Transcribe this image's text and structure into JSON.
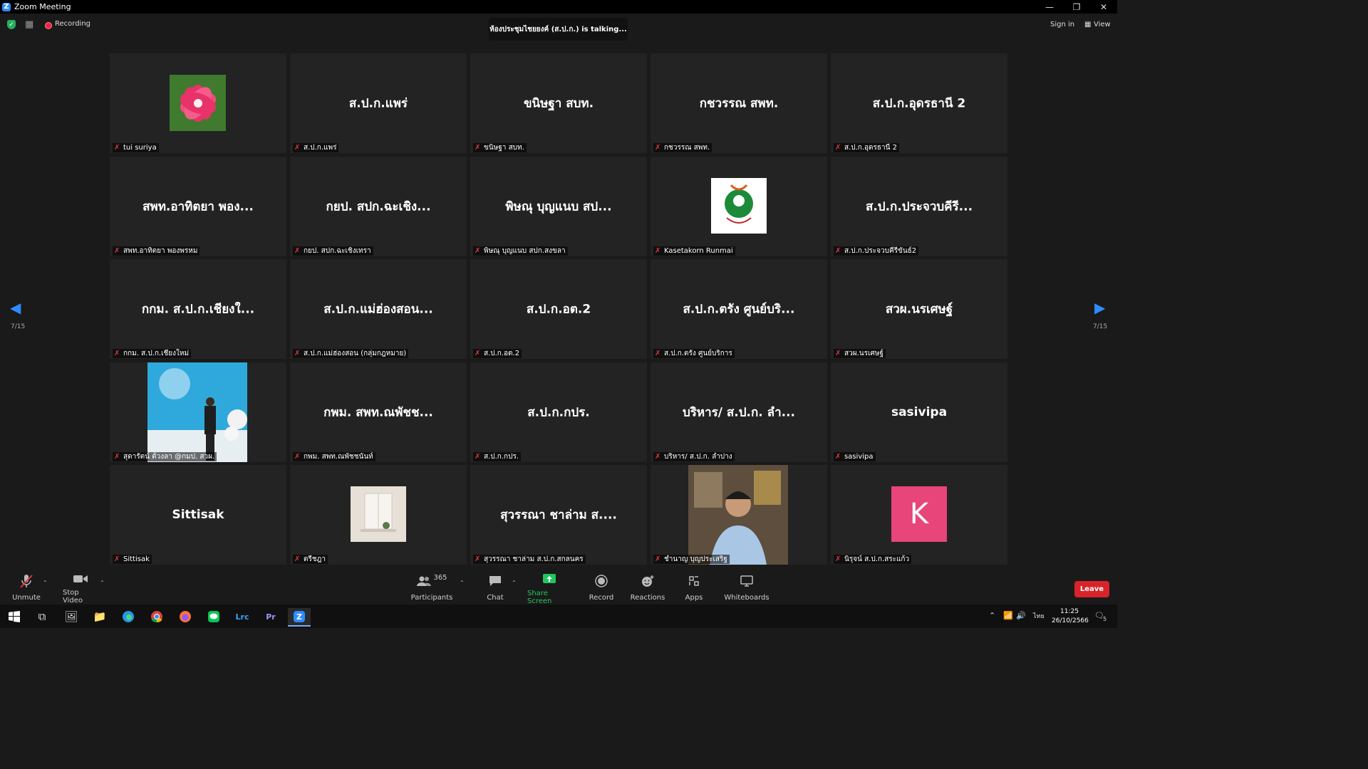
{
  "window": {
    "title": "Zoom Meeting",
    "controls": [
      "—",
      "❐",
      "✕"
    ]
  },
  "topbar": {
    "recording_label": "Recording",
    "talking_toast": "ห้องประชุมไชยยงค์ (ส.ป.ก.) is talking...",
    "signin_label": "Sign in",
    "view_label": "View"
  },
  "pagination": {
    "left": "7/15",
    "right": "7/15"
  },
  "participants": [
    {
      "tile_text": "",
      "label": "tui suriya",
      "avatar": "flower"
    },
    {
      "tile_text": "ส.ป.ก.แพร่",
      "label": "ส.ป.ก.แพร่"
    },
    {
      "tile_text": "ขนิษฐา สบท.",
      "label": "ขนิษฐา สบท."
    },
    {
      "tile_text": "กชวรรณ สพท.",
      "label": "กชวรรณ สพท."
    },
    {
      "tile_text": "ส.ป.ก.อุดรธานี 2",
      "label": "ส.ป.ก.อุดรธานี 2"
    },
    {
      "tile_text": "สพท.อาทิตยา พอง...",
      "label": "สพท.อาทิตยา พองพรหม"
    },
    {
      "tile_text": "กยป. สปก.ฉะเชิง...",
      "label": "กยป. สปก.ฉะเชิงเทรา"
    },
    {
      "tile_text": "พิษณุ บุญแนบ สป...",
      "label": "พิษณุ บุญแนบ สปก.สงขลา"
    },
    {
      "tile_text": "",
      "label": "Kasetakorn Runmai",
      "avatar": "logo"
    },
    {
      "tile_text": "ส.ป.ก.ประจวบคีรี...",
      "label": "ส.ป.ก.ประจวบคีรีขันธ์2"
    },
    {
      "tile_text": "กกม. ส.ป.ก.เชียงใ...",
      "label": "กกม. ส.ป.ก.เชียงใหม่"
    },
    {
      "tile_text": "ส.ป.ก.แม่ฮ่องสอน...",
      "label": "ส.ป.ก.แม่ฮ่องสอน (กลุ่มกฎหมาย)"
    },
    {
      "tile_text": "ส.ป.ก.อต.2",
      "label": "ส.ป.ก.อต.2"
    },
    {
      "tile_text": "ส.ป.ก.ตรัง ศูนย์บริ...",
      "label": "ส.ป.ก.ตรัง ศูนย์บริการ"
    },
    {
      "tile_text": "สวผ.นรเศษฐ์",
      "label": "สวผ.นรเศษฐ์"
    },
    {
      "tile_text": "",
      "label": "สุดารัตน์ ต้วงลา @กมป. สวผ.",
      "avatar": "photo-woman"
    },
    {
      "tile_text": "กพม. สพท.ณพัชช...",
      "label": "กพม. สพท.ณพัชชนันท์"
    },
    {
      "tile_text": "ส.ป.ก.กปร.",
      "label": "ส.ป.ก.กปร."
    },
    {
      "tile_text": "บริหาร/ ส.ป.ก. ลำ...",
      "label": "บริหาร/ ส.ป.ก. ลำปาง"
    },
    {
      "tile_text": "sasivipa",
      "label": "sasivipa"
    },
    {
      "tile_text": "Sittisak",
      "label": "Sittisak"
    },
    {
      "tile_text": "",
      "label": "ตรีชฎา",
      "avatar": "window-room"
    },
    {
      "tile_text": "สุวรรณา ชาล่าม ส....",
      "label": "สุวรรณา ชาล่าม ส.ป.ก.สกลนคร"
    },
    {
      "tile_text": "",
      "label": "ชำนาญ บุญประเสริฐ",
      "avatar": "photo-man"
    },
    {
      "tile_text": "",
      "label": "นิรุจน์ ส.ป.ก.สระแก้ว",
      "avatar": "letter",
      "avatar_letter": "K",
      "avatar_color": "#e8457a"
    }
  ],
  "toolbar": {
    "unmute": "Unmute",
    "stop_video": "Stop Video",
    "participants_count": "365",
    "participants": "Participants",
    "chat": "Chat",
    "share_screen": "Share Screen",
    "record": "Record",
    "reactions": "Reactions",
    "apps": "Apps",
    "whiteboards": "Whiteboards",
    "leave": "Leave"
  },
  "taskbar": {
    "time": "11:25",
    "date": "26/10/2566",
    "lang": "ไทย",
    "notif_count": "5"
  },
  "colors": {
    "accent": "#2d8cff",
    "share_green": "#22c55e",
    "leave_red": "#d8232a",
    "muted_red": "#e0383e"
  }
}
